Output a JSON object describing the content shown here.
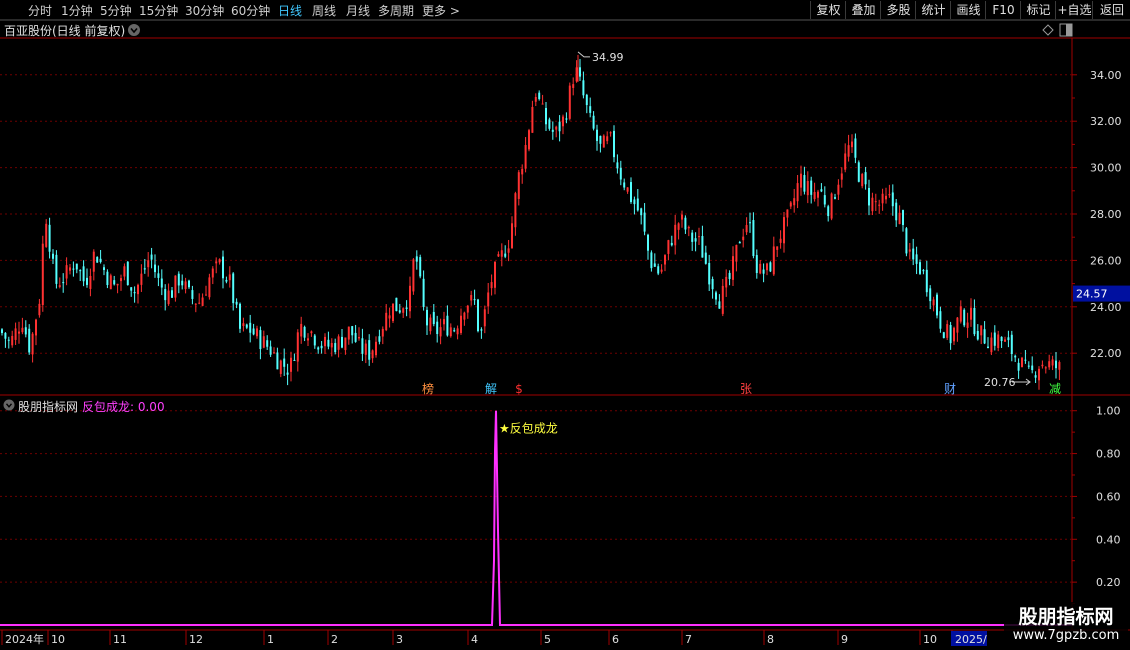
{
  "toolbar": {
    "periods": [
      "分时",
      "1分钟",
      "5分钟",
      "15分钟",
      "30分钟",
      "60分钟",
      "日线",
      "周线",
      "月线",
      "多周期",
      "更多 >"
    ],
    "active_period": "日线",
    "right_buttons": [
      "复权",
      "叠加",
      "多股",
      "统计",
      "画线",
      "F10",
      "标记",
      "+自选",
      "返回"
    ]
  },
  "main_header": {
    "title": "百亚股份(日线 前复权)"
  },
  "indicator_header": {
    "name": "股朋指标网",
    "series_label": "反包成龙: 0.00"
  },
  "main_chart": {
    "y_ticks": [
      "34.00",
      "32.00",
      "30.00",
      "28.00",
      "26.00",
      "24.00",
      "22.00"
    ],
    "last_price": "24.57",
    "high_label": "34.99",
    "low_label": "20.76",
    "event_tags": [
      {
        "text": "榜",
        "color": "#ff9040"
      },
      {
        "text": "解",
        "color": "#40c8ff"
      },
      {
        "text": "$",
        "color": "#ff3030"
      },
      {
        "text": "张",
        "color": "#ff4040"
      },
      {
        "text": "财",
        "color": "#60a0ff"
      },
      {
        "text": "减",
        "color": "#40ff40"
      }
    ]
  },
  "indicator_chart": {
    "y_ticks": [
      "1.00",
      "0.80",
      "0.60",
      "0.40",
      "0.20"
    ],
    "signal_label": "★反包成龙",
    "signal_color": "#ff30ff"
  },
  "x_axis": {
    "labels": [
      "2024年",
      "10",
      "11",
      "12",
      "1",
      "2",
      "3",
      "4",
      "5",
      "6",
      "7",
      "8",
      "9",
      "10",
      "2025/"
    ]
  },
  "watermark": {
    "line1": "股朋指标网",
    "line2": "www.7gpzb.com"
  },
  "colors": {
    "up": "#ff3232",
    "down": "#54ffff",
    "grid": "#6e0000",
    "axis": "#a00000"
  },
  "chart_data": {
    "type": "candlestick",
    "ylim": [
      20.5,
      35.5
    ],
    "high": 34.99,
    "low": 20.76,
    "last": 24.57,
    "indicator": {
      "name": "反包成龙",
      "ylim": [
        0,
        1.05
      ],
      "spike_value": 1.0
    }
  }
}
